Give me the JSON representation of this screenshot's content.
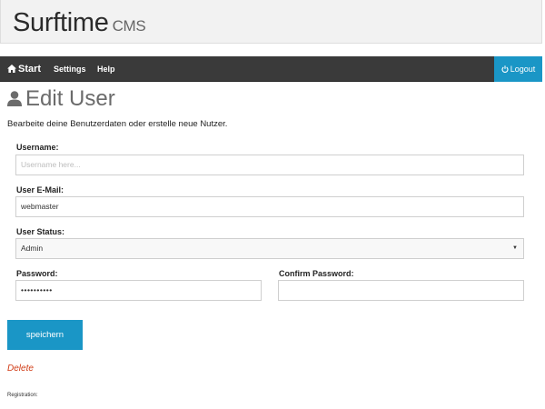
{
  "app": {
    "brand": "Surftime",
    "brand_sub": "CMS"
  },
  "nav": {
    "start": "Start",
    "settings": "Settings",
    "help": "Help",
    "logout": "Logout"
  },
  "page": {
    "title": "Edit User",
    "intro": "Bearbeite deine Benutzerdaten oder erstelle neue Nutzer."
  },
  "form": {
    "username_label": "Username:",
    "username_placeholder": "Username here...",
    "email_label": "User E-Mail:",
    "email_value": "webmaster",
    "status_label": "User Status:",
    "status_value": "Admin",
    "password_label": "Password:",
    "password_value": "••••••••••",
    "confirm_label": "Confirm Password:",
    "confirm_value": ""
  },
  "actions": {
    "save": "speichern",
    "delete": "Delete"
  },
  "footer": {
    "registration": "Registration:"
  },
  "colors": {
    "accent": "#1a96c6",
    "navbar": "#3a3a3a",
    "delete": "#d03b15"
  }
}
